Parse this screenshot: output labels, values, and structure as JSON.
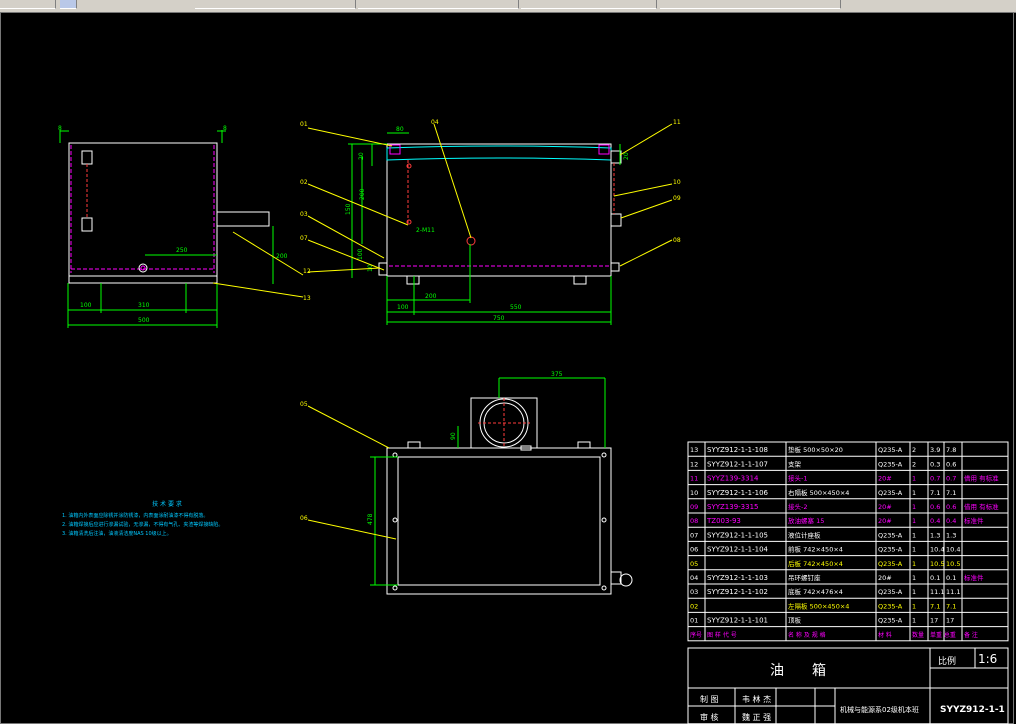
{
  "toolbar": {
    "segments": [
      "",
      "",
      "",
      "",
      "",
      ""
    ]
  },
  "front_view": {
    "labels": [
      "250",
      "200",
      "100",
      "310",
      "500",
      "8"
    ],
    "callouts": [
      "12",
      "13"
    ]
  },
  "side_view": {
    "callouts": [
      "01",
      "02",
      "03",
      "04",
      "05",
      "07",
      "11",
      "10",
      "09",
      "08",
      "12",
      "13"
    ],
    "dims": [
      "80",
      "20",
      "200",
      "150",
      "100",
      "10",
      "200",
      "550",
      "750",
      "100",
      "2-M11",
      "20"
    ]
  },
  "top_view": {
    "callouts": [
      "05",
      "06"
    ],
    "dims": [
      "375",
      "90",
      "478"
    ]
  },
  "notes": {
    "title": "技 术 要 求",
    "lines": [
      "1. 油箱内外表面应除锈并涂防锈漆，内表面涂耐油漆不得有脱落。",
      "2. 油箱焊接后应进行渗漏试验，无渗漏，不得有气孔、夹渣等焊接缺陷。",
      "3. 油箱清洗后注油，油液清洁度NAS 10级以上。"
    ]
  },
  "bom": {
    "rows": [
      {
        "no": "13",
        "code": "SYYZ912-1-1-108",
        "name": "垫板 500×50×20",
        "mat": "Q235-A",
        "qty": "2",
        "unit": "3.9",
        "total": "7.8",
        "note": ""
      },
      {
        "no": "12",
        "code": "SYYZ912-1-1-107",
        "name": "支架",
        "mat": "Q235-A",
        "qty": "2",
        "unit": "0.3",
        "total": "0.6",
        "note": ""
      },
      {
        "no": "11",
        "code": "SYYZ139-3314",
        "name": "接头-1",
        "mat": "20#",
        "qty": "1",
        "unit": "0.7",
        "total": "0.7",
        "note": "借用 有标准"
      },
      {
        "no": "10",
        "code": "SYYZ912-1-1-106",
        "name": "右隔板 500×450×4",
        "mat": "Q235-A",
        "qty": "1",
        "unit": "7.1",
        "total": "7.1",
        "note": ""
      },
      {
        "no": "09",
        "code": "SYYZ139-3315",
        "name": "接头-2",
        "mat": "20#",
        "qty": "1",
        "unit": "0.6",
        "total": "0.6",
        "note": "借用 有标准"
      },
      {
        "no": "08",
        "code": "TZ003-93",
        "name": "放油螺塞 15",
        "mat": "20#",
        "qty": "1",
        "unit": "0.4",
        "total": "0.4",
        "note": "标准件"
      },
      {
        "no": "07",
        "code": "SYYZ912-1-1-105",
        "name": "液位计座板",
        "mat": "Q235-A",
        "qty": "1",
        "unit": "1.3",
        "total": "1.3",
        "note": ""
      },
      {
        "no": "06",
        "code": "SYYZ912-1-1-104",
        "name": "前板 742×450×4",
        "mat": "Q235-A",
        "qty": "1",
        "unit": "10.4",
        "total": "10.4",
        "note": ""
      },
      {
        "no": "05",
        "code": "",
        "name": "后板 742×450×4",
        "mat": "Q235-A",
        "qty": "1",
        "unit": "10.5",
        "total": "10.5",
        "note": ""
      },
      {
        "no": "04",
        "code": "SYYZ912-1-1-103",
        "name": "吊环螺钉座",
        "mat": "20#",
        "qty": "1",
        "unit": "0.1",
        "total": "0.1",
        "note": "标准件"
      },
      {
        "no": "03",
        "code": "SYYZ912-1-1-102",
        "name": "底板 742×476×4",
        "mat": "Q235-A",
        "qty": "1",
        "unit": "11.1",
        "total": "11.1",
        "note": ""
      },
      {
        "no": "02",
        "code": "",
        "name": "左隔板 500×450×4",
        "mat": "Q235-A",
        "qty": "1",
        "unit": "7.1",
        "total": "7.1",
        "note": ""
      },
      {
        "no": "01",
        "code": "SYYZ912-1-1-101",
        "name": "顶板",
        "mat": "Q235-A",
        "qty": "1",
        "unit": "17",
        "total": "17",
        "note": ""
      }
    ],
    "header": {
      "no": "序号",
      "code": "图 样 代 号",
      "name": "名 称 及 规 格",
      "mat": "材 料",
      "qty": "数量",
      "weight": "单重 总重",
      "note": "备 注"
    }
  },
  "title_block": {
    "title": "油　　箱",
    "scale_label": "比例",
    "scale": "1:6",
    "draw_label": "制 图",
    "drawer": "韦 林 杰",
    "check_label": "审 核",
    "checker": "魏 正 强",
    "org": "机械与能源系02级机本班",
    "drawing_no": "SYYZ912-1-1"
  },
  "colors": {
    "line": "#ffffff",
    "dim": "#00ff00",
    "leader": "#ffff00",
    "hidden": "#ff00ff",
    "red": "#ff3b3b",
    "cyan": "#00ffff",
    "bg": "#000000"
  }
}
